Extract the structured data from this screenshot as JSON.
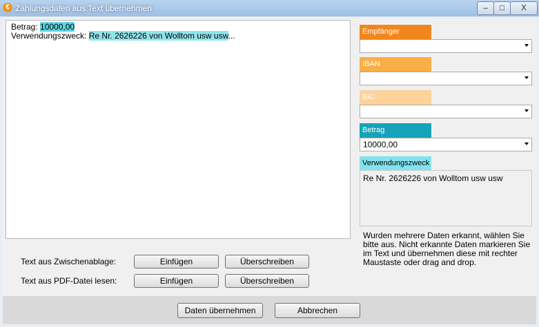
{
  "window": {
    "title": "Zahlungsdaten aus Text übernehmen",
    "icon": "app-logo-icon",
    "controls": {
      "minimize": "–",
      "maximize": "□",
      "close": "X"
    }
  },
  "text_area": {
    "line1_label": "Betrag: ",
    "line1_value": "10000,00",
    "line2_label": "Verwendungszweck: ",
    "line2_value": "Re Nr. 2626226 von Wolltom usw usw",
    "line2_suffix": "..."
  },
  "fields": {
    "empfaenger": {
      "label": "Empfänger",
      "value": "",
      "color": "#f2861e"
    },
    "iban": {
      "label": "IBAN",
      "value": "",
      "color": "#f9ae46"
    },
    "bic": {
      "label": "BIC",
      "value": "",
      "color": "#fdd39b"
    },
    "betrag": {
      "label": "Betrag",
      "value": "10000,00",
      "color": "#16a3b7"
    },
    "verwendungszweck": {
      "label": "Verwendungszweck",
      "value": "Re Nr. 2626226 von Wolltom usw usw",
      "color": "#82e3ef"
    }
  },
  "hint": "Wurden mehrere Daten erkannt, wählen Sie bitte aus. Nicht erkannte Daten markieren Sie im Text und übernehmen diese mit rechter Maustaste oder drag and drop.",
  "import": {
    "clipboard_label": "Text aus Zwischenablage:",
    "pdf_label": "Text aus PDF-Datei lesen:",
    "insert_label": "Einfügen",
    "overwrite_label": "Überschreiben"
  },
  "footer": {
    "accept_label": "Daten übernehmen",
    "cancel_label": "Abbrechen"
  }
}
